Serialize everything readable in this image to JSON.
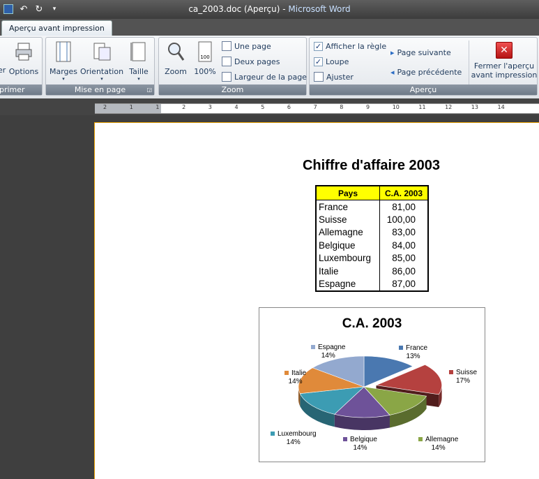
{
  "window": {
    "doc": "ca_2003.doc (Aperçu)",
    "sep": " - ",
    "app": "Microsoft Word"
  },
  "tabs": [
    {
      "label": "Aperçu avant impression"
    }
  ],
  "ribbon": {
    "print_group": {
      "label": "primer",
      "opt_prefix": "er",
      "options": "Options"
    },
    "mise_en_page": {
      "label": "Mise en page",
      "marges": "Marges",
      "orientation": "Orientation",
      "taille": "Taille"
    },
    "zoom": {
      "label": "Zoom",
      "zoom": "Zoom",
      "pct": "100%",
      "une_page": "Une page",
      "deux_pages": "Deux pages",
      "largeur": "Largeur de la page"
    },
    "apercu": {
      "label": "Aperçu",
      "regle": "Afficher la règle",
      "loupe": "Loupe",
      "ajuster": "Ajuster",
      "suivante": "Page suivante",
      "precedente": "Page précédente",
      "fermer1": "Fermer l'aperçu",
      "fermer2": "avant impression"
    }
  },
  "ruler_ticks": [
    "2",
    "1",
    "1",
    "2",
    "3",
    "4",
    "5",
    "6",
    "7",
    "8",
    "9",
    "10",
    "11",
    "12",
    "13",
    "14"
  ],
  "document": {
    "title": "Chiffre d'affaire 2003",
    "table": {
      "headers": [
        "Pays",
        "C.A. 2003"
      ],
      "rows": [
        [
          "France",
          "81,00"
        ],
        [
          "Suisse",
          "100,00"
        ],
        [
          "Allemagne",
          "83,00"
        ],
        [
          "Belgique",
          "84,00"
        ],
        [
          "Luxembourg",
          "85,00"
        ],
        [
          "Italie",
          "86,00"
        ],
        [
          "Espagne",
          "87,00"
        ]
      ]
    }
  },
  "chart_data": {
    "type": "pie",
    "title": "C.A. 2003",
    "categories": [
      "France",
      "Suisse",
      "Allemagne",
      "Belgique",
      "Luxembourg",
      "Italie",
      "Espagne"
    ],
    "values": [
      81,
      100,
      83,
      84,
      85,
      86,
      87
    ],
    "labels": [
      "13%",
      "17%",
      "14%",
      "14%",
      "14%",
      "14%",
      "14%"
    ],
    "colors": [
      "#4a78b0",
      "#b5413f",
      "#8aa646",
      "#6e5299",
      "#3c9cb3",
      "#e08a3a",
      "#93a9cf"
    ],
    "exploded": "Suisse"
  }
}
